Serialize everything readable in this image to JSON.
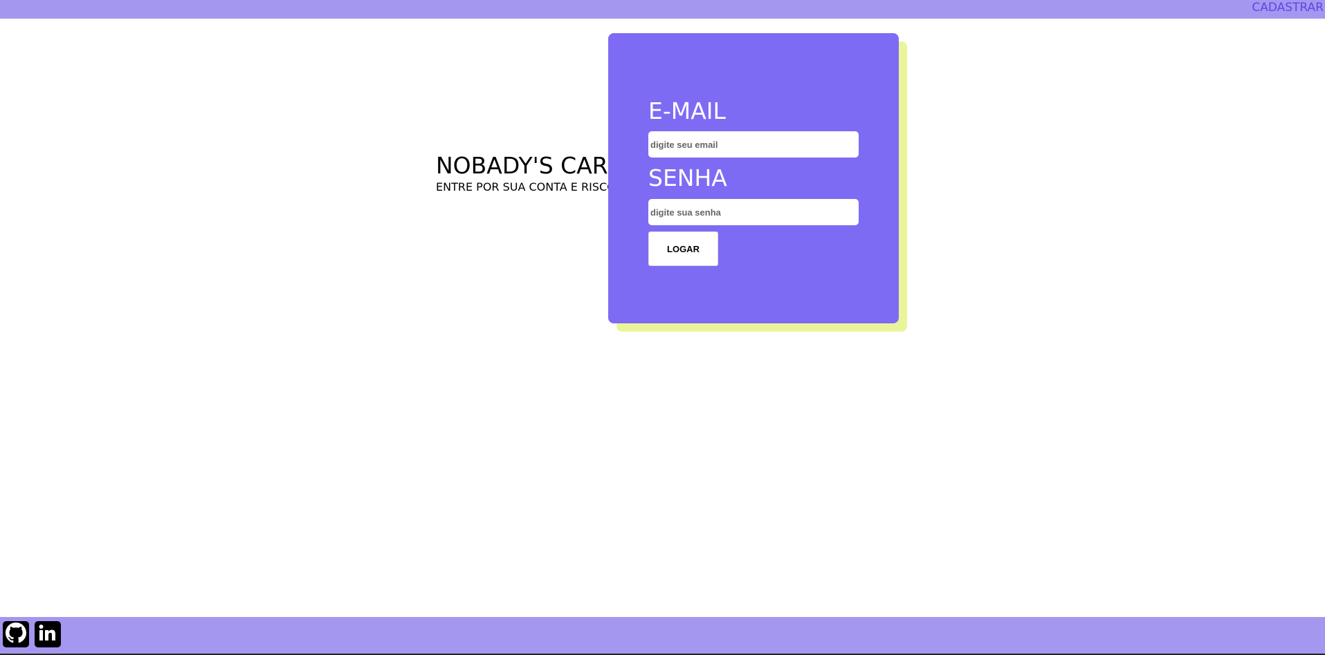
{
  "topbar": {
    "register_link": "CADASTRAR"
  },
  "brand": {
    "title": "NOBADY'S CARE",
    "subtitle": "ENTRE POR SUA CONTA E RISCO"
  },
  "form": {
    "email_label": "E-MAIL",
    "email_placeholder": "digite seu email",
    "password_label": "SENHA",
    "password_placeholder": "digite sua senha",
    "login_button": "LOGAR"
  },
  "footer": {
    "icons": [
      "github-icon",
      "linkedin-icon"
    ]
  },
  "colors": {
    "bar": "#a497f0",
    "card": "#7e6bf4",
    "card_shadow": "#eaf59a",
    "link": "#5b46e8"
  }
}
